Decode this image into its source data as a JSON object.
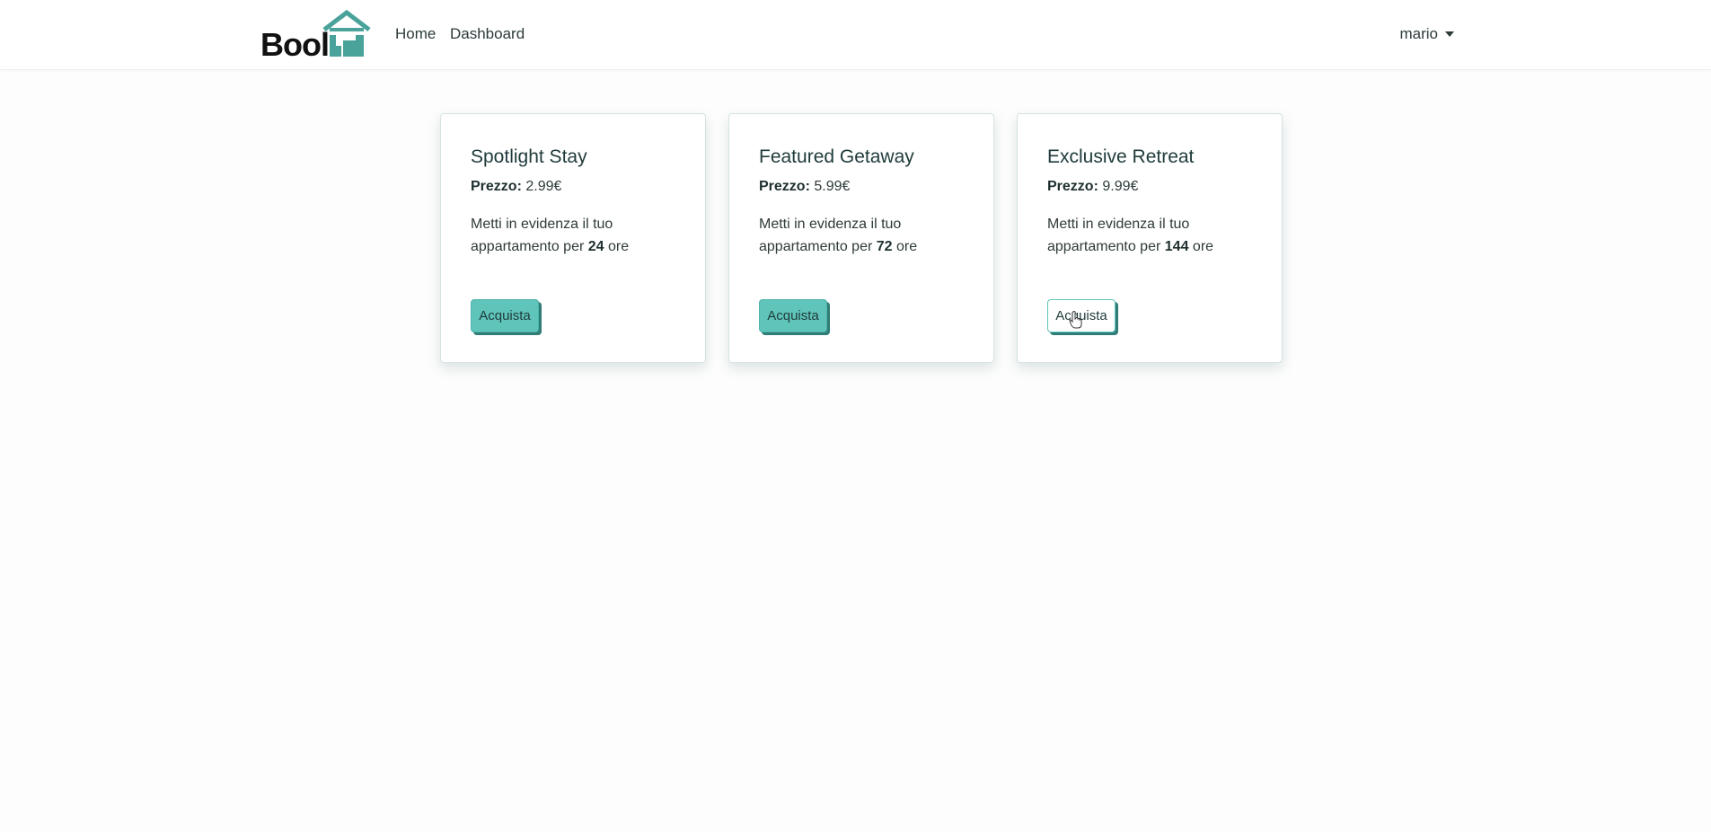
{
  "header": {
    "logo_text": "Bool",
    "logo_mark": "bnb",
    "nav": [
      {
        "label": "Home"
      },
      {
        "label": "Dashboard"
      }
    ],
    "user": {
      "name": "mario"
    }
  },
  "plans": [
    {
      "title": "Spotlight Stay",
      "price_label": "Prezzo:",
      "price": "2.99€",
      "desc_prefix": "Metti in evidenza il tuo appartamento per",
      "hours": "24",
      "desc_suffix": "ore",
      "button": "Acquista"
    },
    {
      "title": "Featured Getaway",
      "price_label": "Prezzo:",
      "price": "5.99€",
      "desc_prefix": "Metti in evidenza il tuo appartamento per",
      "hours": "72",
      "desc_suffix": "ore",
      "button": "Acquista"
    },
    {
      "title": "Exclusive Retreat",
      "price_label": "Prezzo:",
      "price": "9.99€",
      "desc_prefix": "Metti in evidenza il tuo appartamento per",
      "hours": "144",
      "desc_suffix": "ore",
      "button": "Acquista"
    }
  ],
  "colors": {
    "brand": "#4aa39b",
    "button_fill": "#5fc5bb",
    "button_shadow": "#2f7d76"
  }
}
